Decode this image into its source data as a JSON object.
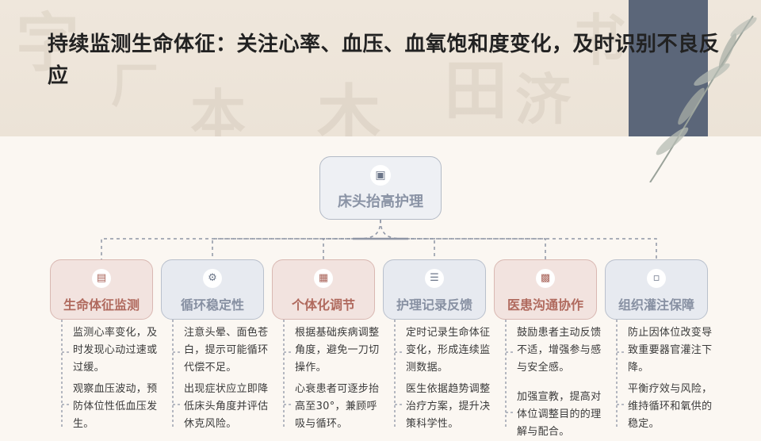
{
  "title": "持续监测生命体征：关注心率、血压、血氧饱和度变化，及时识别不良反应",
  "root": {
    "label": "床头抬高护理",
    "icon": "truck-icon"
  },
  "branches": [
    {
      "label": "生命体征监测",
      "icon": "document-icon",
      "bullets": [
        "监测心率变化，及时发现心动过速或过缓。",
        "观察血压波动，预防体位性低血压发生。"
      ]
    },
    {
      "label": "循环稳定性",
      "icon": "gear-icon",
      "bullets": [
        "注意头晕、面色苍白，提示可能循环代偿不足。",
        "出现症状应立即降低床头角度并评估休克风险。"
      ]
    },
    {
      "label": "个体化调节",
      "icon": "folder-icon",
      "bullets": [
        "根据基础疾病调整角度，避免一刀切操作。",
        "心衰患者可逐步抬高至30°，兼顾呼吸与循环。"
      ]
    },
    {
      "label": "护理记录反馈",
      "icon": "list-icon",
      "bullets": [
        "定时记录生命体征变化，形成连续监测数据。",
        "医生依据趋势调整治疗方案，提升决策科学性。"
      ]
    },
    {
      "label": "医患沟通协作",
      "icon": "id-card-icon",
      "bullets": [
        "鼓励患者主动反馈不适，增强参与感与安全感。",
        "加强宣教，提高对体位调整目的的理解与配合。"
      ]
    },
    {
      "label": "组织灌注保障",
      "icon": "clipboard-icon",
      "bullets": [
        "防止因体位改变导致重要器官灌注下降。",
        "平衡疗效与风险，维持循环和氧供的稳定。"
      ]
    }
  ],
  "colors": {
    "accent": "#5b6679",
    "warm": "#b06a5e",
    "cool": "#8790a2"
  }
}
